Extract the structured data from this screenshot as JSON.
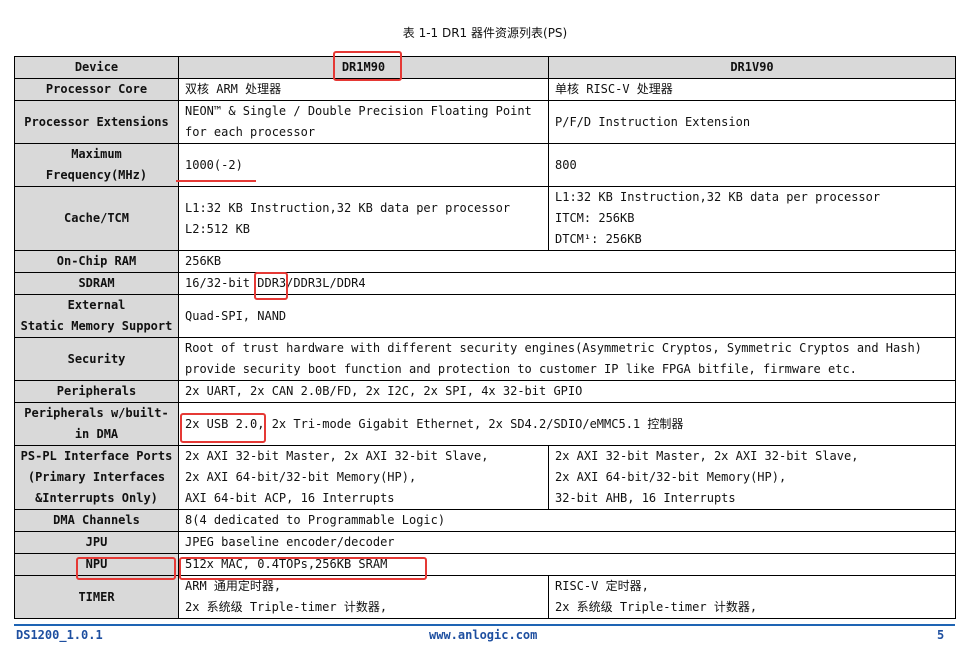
{
  "caption": "表 1-1 DR1 器件资源列表(PS)",
  "table": {
    "headers": [
      "Device",
      "DR1M90",
      "DR1V90"
    ],
    "rows": [
      {
        "label": [
          "Processor Core"
        ],
        "span": false,
        "m": [
          "双核 ARM 处理器"
        ],
        "v": [
          "单核 RISC-V 处理器"
        ]
      },
      {
        "label": [
          "Processor Extensions"
        ],
        "span": false,
        "m": [
          "NEON™ & Single / Double Precision Floating Point",
          "for each processor"
        ],
        "v": [
          "P/F/D Instruction Extension"
        ]
      },
      {
        "label": [
          "Maximum",
          "Frequency(MHz)"
        ],
        "span": false,
        "m": [
          "1000(-2)"
        ],
        "v": [
          "800"
        ]
      },
      {
        "label": [
          "Cache/TCM"
        ],
        "span": false,
        "m": [
          "L1:32 KB Instruction,32 KB data per processor",
          "L2:512 KB"
        ],
        "v": [
          "L1:32 KB Instruction,32 KB data per processor",
          "ITCM: 256KB",
          "DTCM¹: 256KB"
        ]
      },
      {
        "label": [
          "On-Chip RAM"
        ],
        "span": true,
        "m": [
          "256KB"
        ]
      },
      {
        "label": [
          "SDRAM"
        ],
        "span": true,
        "m": [
          "16/32-bit DDR3/DDR3L/DDR4"
        ]
      },
      {
        "label": [
          "External",
          "Static Memory Support"
        ],
        "span": true,
        "m": [
          "Quad-SPI, NAND"
        ]
      },
      {
        "label": [
          "Security"
        ],
        "span": true,
        "m": [
          "Root of trust hardware with different security engines(Asymmetric Cryptos, Symmetric Cryptos and Hash)",
          "provide security boot function and protection to customer IP like FPGA bitfile, firmware etc."
        ]
      },
      {
        "label": [
          "Peripherals"
        ],
        "span": true,
        "m": [
          "2x UART, 2x CAN 2.0B/FD, 2x I2C, 2x SPI, 4x 32-bit GPIO"
        ]
      },
      {
        "label": [
          "Peripherals w/built-",
          "in DMA"
        ],
        "span": true,
        "m": [
          "2x USB 2.0, 2x Tri-mode Gigabit Ethernet, 2x SD4.2/SDIO/eMMC5.1 控制器"
        ]
      },
      {
        "label": [
          "PS-PL Interface Ports",
          "(Primary Interfaces",
          "&Interrupts Only)"
        ],
        "span": false,
        "m": [
          "2x AXI 32-bit Master, 2x AXI 32-bit Slave,",
          "2x AXI 64-bit/32-bit Memory(HP),",
          "AXI 64-bit ACP, 16 Interrupts"
        ],
        "v": [
          "2x AXI 32-bit Master, 2x AXI 32-bit Slave,",
          "2x AXI 64-bit/32-bit Memory(HP),",
          "32-bit AHB, 16 Interrupts"
        ]
      },
      {
        "label": [
          "DMA Channels"
        ],
        "span": true,
        "m": [
          "8(4 dedicated to Programmable Logic)"
        ]
      },
      {
        "label": [
          "JPU"
        ],
        "span": true,
        "m": [
          "JPEG baseline encoder/decoder"
        ]
      },
      {
        "label": [
          "NPU"
        ],
        "span": true,
        "m": [
          "512x MAC, 0.4TOPs,256KB SRAM"
        ]
      },
      {
        "label": [
          "TIMER"
        ],
        "span": false,
        "m": [
          "ARM 通用定时器,",
          "2x 系统级 Triple-timer 计数器,"
        ],
        "v": [
          "RISC-V 定时器,",
          "2x 系统级 Triple-timer 计数器,"
        ]
      }
    ]
  },
  "footer": {
    "doc_id": "DS1200_1.0.1",
    "website": "www.anlogic.com",
    "page": "5"
  },
  "colors": {
    "header_bg": "#d9d9d9",
    "annotation": "#e53935",
    "footer_blue": "#1e4fa0"
  }
}
